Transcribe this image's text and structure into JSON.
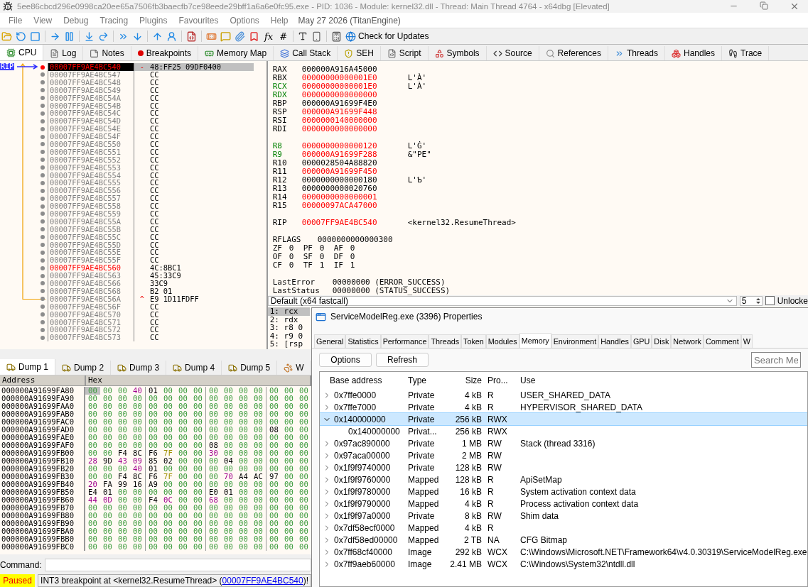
{
  "window": {
    "title": "5ee86cbcd296e0998ca20ee65a7506fb3baecfb7ce98eede29bff1a6a6e0fc95.exe - PID: 1036 - Module: kernel32.dll - Thread: Main Thread 4764 - x64dbg [Elevated]"
  },
  "menu": {
    "items": [
      "File",
      "View",
      "Debug",
      "Tracing",
      "Plugins",
      "Favourites",
      "Options",
      "Help"
    ],
    "build": "May 27 2026 (TitanEngine)"
  },
  "toolbar": {
    "symbols": [
      "fx",
      "#"
    ],
    "update_button": "Check for Updates"
  },
  "tabs": [
    {
      "label": "CPU",
      "selected": true
    },
    {
      "label": "Log",
      "selected": false
    },
    {
      "label": "Notes",
      "selected": false
    },
    {
      "label": "Breakpoints",
      "selected": false
    },
    {
      "label": "Memory Map",
      "selected": false
    },
    {
      "label": "Call Stack",
      "selected": false
    },
    {
      "label": "SEH",
      "selected": false
    },
    {
      "label": "Script",
      "selected": false
    },
    {
      "label": "Symbols",
      "selected": false
    },
    {
      "label": "Source",
      "selected": false
    },
    {
      "label": "References",
      "selected": false
    },
    {
      "label": "Threads",
      "selected": false
    },
    {
      "label": "Handles",
      "selected": false
    },
    {
      "label": "Trace",
      "selected": false
    }
  ],
  "disasm": {
    "rip_label": "RIP",
    "rows": [
      {
        "address": "00007FF9AE4BC540",
        "marker": "-",
        "bytes": "48:FF25 09DF0400",
        "breakpoint": true,
        "current": true,
        "label": false
      },
      {
        "address": "00007FF9AE4BC547",
        "bytes": "CC",
        "breakpoint": false,
        "current": false,
        "label": false
      },
      {
        "address": "00007FF9AE4BC548",
        "bytes": "CC",
        "breakpoint": false,
        "current": false,
        "label": false
      },
      {
        "address": "00007FF9AE4BC549",
        "bytes": "CC",
        "breakpoint": false,
        "current": false,
        "label": false
      },
      {
        "address": "00007FF9AE4BC54A",
        "bytes": "CC",
        "breakpoint": false,
        "current": false,
        "label": false
      },
      {
        "address": "00007FF9AE4BC54B",
        "bytes": "CC",
        "breakpoint": false,
        "current": false,
        "label": false
      },
      {
        "address": "00007FF9AE4BC54C",
        "bytes": "CC",
        "breakpoint": false,
        "current": false,
        "label": false
      },
      {
        "address": "00007FF9AE4BC54D",
        "bytes": "CC",
        "breakpoint": false,
        "current": false,
        "label": false
      },
      {
        "address": "00007FF9AE4BC54E",
        "bytes": "CC",
        "breakpoint": false,
        "current": false,
        "label": false
      },
      {
        "address": "00007FF9AE4BC54F",
        "bytes": "CC",
        "breakpoint": false,
        "current": false,
        "label": false
      },
      {
        "address": "00007FF9AE4BC550",
        "bytes": "CC",
        "breakpoint": false,
        "current": false,
        "label": false
      },
      {
        "address": "00007FF9AE4BC551",
        "bytes": "CC",
        "breakpoint": false,
        "current": false,
        "label": false
      },
      {
        "address": "00007FF9AE4BC552",
        "bytes": "CC",
        "breakpoint": false,
        "current": false,
        "label": false
      },
      {
        "address": "00007FF9AE4BC553",
        "bytes": "CC",
        "breakpoint": false,
        "current": false,
        "label": false
      },
      {
        "address": "00007FF9AE4BC554",
        "bytes": "CC",
        "breakpoint": false,
        "current": false,
        "label": false
      },
      {
        "address": "00007FF9AE4BC555",
        "bytes": "CC",
        "breakpoint": false,
        "current": false,
        "label": false
      },
      {
        "address": "00007FF9AE4BC556",
        "bytes": "CC",
        "breakpoint": false,
        "current": false,
        "label": false
      },
      {
        "address": "00007FF9AE4BC557",
        "bytes": "CC",
        "breakpoint": false,
        "current": false,
        "label": false
      },
      {
        "address": "00007FF9AE4BC558",
        "bytes": "CC",
        "breakpoint": false,
        "current": false,
        "label": false
      },
      {
        "address": "00007FF9AE4BC559",
        "bytes": "CC",
        "breakpoint": false,
        "current": false,
        "label": false
      },
      {
        "address": "00007FF9AE4BC55A",
        "bytes": "CC",
        "breakpoint": false,
        "current": false,
        "label": false
      },
      {
        "address": "00007FF9AE4BC55B",
        "bytes": "CC",
        "breakpoint": false,
        "current": false,
        "label": false
      },
      {
        "address": "00007FF9AE4BC55C",
        "bytes": "CC",
        "breakpoint": false,
        "current": false,
        "label": false
      },
      {
        "address": "00007FF9AE4BC55D",
        "bytes": "CC",
        "breakpoint": false,
        "current": false,
        "label": false
      },
      {
        "address": "00007FF9AE4BC55E",
        "bytes": "CC",
        "breakpoint": false,
        "current": false,
        "label": false
      },
      {
        "address": "00007FF9AE4BC55F",
        "bytes": "CC",
        "breakpoint": false,
        "current": false,
        "label": false
      },
      {
        "address": "00007FF9AE4BC560",
        "bytes": "4C:8BC1",
        "breakpoint": false,
        "current": false,
        "label": true
      },
      {
        "address": "00007FF9AE4BC563",
        "bytes": "45:33C9",
        "breakpoint": false,
        "current": false,
        "label": false
      },
      {
        "address": "00007FF9AE4BC566",
        "bytes": "33C9",
        "breakpoint": false,
        "current": false,
        "label": false
      },
      {
        "address": "00007FF9AE4BC568",
        "bytes": "B2 01",
        "breakpoint": false,
        "current": false,
        "label": false
      },
      {
        "address": "00007FF9AE4BC56A",
        "marker": "^",
        "bytes": "E9 1D11FDFF",
        "breakpoint": false,
        "current": false,
        "label": false
      },
      {
        "address": "00007FF9AE4BC56F",
        "bytes": "CC",
        "breakpoint": false,
        "current": false,
        "label": false
      },
      {
        "address": "00007FF9AE4BC570",
        "bytes": "CC",
        "breakpoint": false,
        "current": false,
        "label": false
      },
      {
        "address": "00007FF9AE4BC571",
        "bytes": "CC",
        "breakpoint": false,
        "current": false,
        "label": false
      },
      {
        "address": "00007FF9AE4BC572",
        "bytes": "CC",
        "breakpoint": false,
        "current": false,
        "label": false
      },
      {
        "address": "00007FF9AE4BC573",
        "bytes": "CC",
        "breakpoint": false,
        "current": false,
        "label": false
      }
    ]
  },
  "registers": {
    "groups": [
      [
        {
          "name": "RAX",
          "value": "000000A916A45000",
          "changed": false,
          "arg": false
        },
        {
          "name": "RBX",
          "value": "00000000000001E0",
          "changed": true,
          "arg": false,
          "comment": "L'À'"
        },
        {
          "name": "RCX",
          "value": "00000000000001E0",
          "changed": true,
          "arg": true,
          "comment": "L'À'"
        },
        {
          "name": "RDX",
          "value": "0000000000000000",
          "changed": true,
          "arg": true
        },
        {
          "name": "RBP",
          "value": "000000A91699F4E0",
          "changed": false,
          "arg": false
        },
        {
          "name": "RSP",
          "value": "000000A91699F448",
          "changed": true,
          "arg": false
        },
        {
          "name": "RSI",
          "value": "0000000140000000",
          "changed": true,
          "arg": false
        },
        {
          "name": "RDI",
          "value": "0000000000000000",
          "changed": true,
          "arg": false
        }
      ],
      [
        {
          "name": "R8",
          "value": "0000000000000120",
          "changed": true,
          "arg": true,
          "comment": "L'Ġ'"
        },
        {
          "name": "R9",
          "value": "000000A91699F288",
          "changed": true,
          "arg": true,
          "comment": "&\"PE\""
        },
        {
          "name": "R10",
          "value": "0000028504A88820",
          "changed": false,
          "arg": false
        },
        {
          "name": "R11",
          "value": "000000A91699F450",
          "changed": true,
          "arg": false
        },
        {
          "name": "R12",
          "value": "0000000000000180",
          "changed": false,
          "arg": false,
          "comment": "L'Ƅ'"
        },
        {
          "name": "R13",
          "value": "0000000000020760",
          "changed": false,
          "arg": false
        },
        {
          "name": "R14",
          "value": "0000000000000001",
          "changed": true,
          "arg": false
        },
        {
          "name": "R15",
          "value": "00000097ACA47000",
          "changed": true,
          "arg": false
        }
      ],
      [
        {
          "name": "RIP",
          "value": "00007FF9AE4BC540",
          "changed": true,
          "arg": false,
          "comment": "<kernel32.ResumeThread>"
        }
      ]
    ],
    "rflags": {
      "name": "RFLAGS",
      "value": "0000000000000300"
    },
    "flags": [
      [
        {
          "name": "ZF",
          "value": "0"
        },
        {
          "name": "PF",
          "value": "0"
        },
        {
          "name": "AF",
          "value": "0"
        }
      ],
      [
        {
          "name": "OF",
          "value": "0"
        },
        {
          "name": "SF",
          "value": "0"
        },
        {
          "name": "DF",
          "value": "0"
        }
      ],
      [
        {
          "name": "CF",
          "value": "0"
        },
        {
          "name": "TF",
          "value": "1"
        },
        {
          "name": "IF",
          "value": "1"
        }
      ]
    ],
    "last": [
      {
        "name": "LastError",
        "value": "00000000 (ERROR_SUCCESS)"
      },
      {
        "name": "LastStatus",
        "value": "00000000 (STATUS_SUCCESS)"
      }
    ]
  },
  "call_args": {
    "convention": "Default (x64 fastcall)",
    "count": "5",
    "unlock": {
      "label": "Unlocke",
      "checked": false
    },
    "rows": [
      {
        "text": "1: rcx",
        "selected": true
      },
      {
        "text": "2: rdx",
        "selected": false
      },
      {
        "text": "3: r8 0",
        "selected": false
      },
      {
        "text": "4: r9 0",
        "selected": false
      },
      {
        "text": "5: [rsp",
        "selected": false
      }
    ]
  },
  "dump": {
    "tabs": [
      {
        "label": "Dump 1",
        "selected": true
      },
      {
        "label": "Dump 2",
        "selected": false
      },
      {
        "label": "Dump 3",
        "selected": false
      },
      {
        "label": "Dump 4",
        "selected": false
      },
      {
        "label": "Dump 5",
        "selected": false
      },
      {
        "label": "W",
        "selected": false
      }
    ],
    "columns": [
      "Address",
      "Hex"
    ],
    "rows": [
      {
        "address": "000000A91699FA80",
        "bytes": "00 00 00 40 01 00 00 00 00 00 00 00 00 00 00",
        "selected": true
      },
      {
        "address": "000000A91699FA90",
        "bytes": "00 00 00 00 00 00 00 00 00 00 00 00 00 00 00",
        "selected": false
      },
      {
        "address": "000000A91699FAA0",
        "bytes": "00 00 00 00 00 00 00 00 00 00 00 00 00 00 00",
        "selected": false
      },
      {
        "address": "000000A91699FAB0",
        "bytes": "00 00 00 00 00 00 00 00 00 00 00 00 00 00 00",
        "selected": false
      },
      {
        "address": "000000A91699FAC0",
        "bytes": "00 00 00 00 00 00 00 00 00 00 00 00 00 00 00",
        "selected": false
      },
      {
        "address": "000000A91699FAD0",
        "bytes": "00 00 00 00 00 00 00 00 00 00 00 00 08 00 00",
        "selected": false
      },
      {
        "address": "000000A91699FAE0",
        "bytes": "00 00 00 00 00 00 00 00 00 00 00 00 00 00 00",
        "selected": false
      },
      {
        "address": "000000A91699FAF0",
        "bytes": "00 00 00 00 00 00 00 00 08 00 00 00 00 00 00",
        "selected": false
      },
      {
        "address": "000000A91699FB00",
        "bytes": "00 00 F4 8C F6 7F 00 00 30 00 00 00 00 00 00",
        "selected": false
      },
      {
        "address": "000000A91699FB10",
        "bytes": "28 9D 43 09 85 02 00 00 00 04 00 00 00 00 00",
        "selected": false
      },
      {
        "address": "000000A91699FB20",
        "bytes": "00 00 00 40 01 00 00 00 00 00 00 00 00 00 00",
        "selected": false
      },
      {
        "address": "000000A91699FB30",
        "bytes": "00 00 F4 8C F6 7F 00 00 00 70 A4 AC 97 00 00",
        "selected": false
      },
      {
        "address": "000000A91699FB40",
        "bytes": "20 FA 99 16 A9 00 00 00 00 00 00 00 00 00 00",
        "selected": false
      },
      {
        "address": "000000A91699FB50",
        "bytes": "E4 01 00 00 00 00 00 00 E0 01 00 00 00 00 00",
        "selected": false
      },
      {
        "address": "000000A91699FB60",
        "bytes": "44 0D 00 00 F4 0C 00 00 68 00 00 00 00 00 00",
        "selected": false
      },
      {
        "address": "000000A91699FB70",
        "bytes": "00 00 00 00 00 00 00 00 00 00 00 00 00 00 00",
        "selected": false
      },
      {
        "address": "000000A91699FB80",
        "bytes": "00 00 00 00 00 00 00 00 00 00 00 00 00 00 00",
        "selected": false
      },
      {
        "address": "000000A91699FB90",
        "bytes": "00 00 00 00 00 00 00 00 00 00 00 00 00 00 00",
        "selected": false
      },
      {
        "address": "000000A91699FBA0",
        "bytes": "00 00 00 00 00 00 00 00 00 00 00 00 00 00 00",
        "selected": false
      },
      {
        "address": "000000A91699FBB0",
        "bytes": "00 00 00 00 00 00 00 00 00 00 00 00 00 00 00",
        "selected": false
      },
      {
        "address": "000000A91699FBC0",
        "bytes": "00 00 00 00 00 00 00 00 00 00 00 00 00 00 00",
        "selected": false
      }
    ]
  },
  "command": {
    "label": "Command:"
  },
  "status": {
    "state": "Paused",
    "message": "INT3 breakpoint at <kernel32.ResumeThread> (",
    "link": "00007FF9AE4BC540",
    "tail": ")!"
  },
  "properties": {
    "title": "ServiceModelReg.exe (3396) Properties",
    "tabs": [
      {
        "label": "General",
        "selected": false
      },
      {
        "label": "Statistics",
        "selected": false
      },
      {
        "label": "Performance",
        "selected": false
      },
      {
        "label": "Threads",
        "selected": false
      },
      {
        "label": "Token",
        "selected": false
      },
      {
        "label": "Modules",
        "selected": false
      },
      {
        "label": "Memory",
        "selected": true
      },
      {
        "label": "Environment",
        "selected": false
      },
      {
        "label": "Handles",
        "selected": false
      },
      {
        "label": "GPU",
        "selected": false
      },
      {
        "label": "Disk",
        "selected": false
      },
      {
        "label": "Network",
        "selected": false
      },
      {
        "label": "Comment",
        "selected": false
      },
      {
        "label": "W",
        "selected": false
      }
    ],
    "buttons": [
      "Options",
      "Refresh"
    ],
    "search": {
      "placeholder": "Search Me"
    },
    "columns": [
      "Base address",
      "Type",
      "Size",
      "Pro...",
      "Use"
    ],
    "rows": [
      {
        "base": "0x7ffe0000",
        "type": "Private",
        "size": "4 kB",
        "protection": "R",
        "use": "USER_SHARED_DATA",
        "expanded": false,
        "selected": false
      },
      {
        "base": "0x7ffe7000",
        "type": "Private",
        "size": "4 kB",
        "protection": "R",
        "use": "HYPERVISOR_SHARED_DATA",
        "expanded": false,
        "selected": false
      },
      {
        "base": "0x140000000",
        "type": "Private",
        "size": "256 kB",
        "protection": "RWX",
        "expanded": true,
        "selected": true,
        "children": [
          {
            "base": "0x140000000",
            "type": "Privat...",
            "size": "256 kB",
            "protection": "RWX",
            "selected": false
          }
        ]
      },
      {
        "base": "0x97ac890000",
        "type": "Private",
        "size": "1 MB",
        "protection": "RW",
        "use": "Stack (thread 3316)",
        "expanded": false,
        "selected": false
      },
      {
        "base": "0x97aca00000",
        "type": "Private",
        "size": "2 MB",
        "protection": "RW",
        "expanded": false,
        "selected": false
      },
      {
        "base": "0x1f9f9740000",
        "type": "Private",
        "size": "128 kB",
        "protection": "RW",
        "expanded": false,
        "selected": false
      },
      {
        "base": "0x1f9f9760000",
        "type": "Mapped",
        "size": "128 kB",
        "protection": "R",
        "use": "ApiSetMap",
        "expanded": false,
        "selected": false
      },
      {
        "base": "0x1f9f9780000",
        "type": "Mapped",
        "size": "16 kB",
        "protection": "R",
        "use": "System activation context data",
        "expanded": false,
        "selected": false
      },
      {
        "base": "0x1f9f9790000",
        "type": "Mapped",
        "size": "4 kB",
        "protection": "R",
        "use": "Process activation context data",
        "expanded": false,
        "selected": false
      },
      {
        "base": "0x1f9f97a0000",
        "type": "Private",
        "size": "8 kB",
        "protection": "RW",
        "use": "Shim data",
        "expanded": false,
        "selected": false
      },
      {
        "base": "0x7df58ecf0000",
        "type": "Mapped",
        "size": "4 kB",
        "protection": "R",
        "expanded": false,
        "selected": false
      },
      {
        "base": "0x7df58ed00000",
        "type": "Mapped",
        "size": "2 TB",
        "protection": "NA",
        "use": "CFG Bitmap",
        "expanded": false,
        "selected": false
      },
      {
        "base": "0x7ff68cf40000",
        "type": "Image",
        "size": "292 kB",
        "protection": "WCX",
        "use": "C:\\Windows\\Microsoft.NET\\Framework64\\v4.0.30319\\ServiceModelReg.exe",
        "expanded": false,
        "selected": false
      },
      {
        "base": "0x7ff9aeb60000",
        "type": "Image",
        "size": "2.41 MB",
        "protection": "WCX",
        "use": "C:\\Windows\\System32\\ntdll.dll",
        "expanded": false,
        "selected": false
      }
    ]
  }
}
